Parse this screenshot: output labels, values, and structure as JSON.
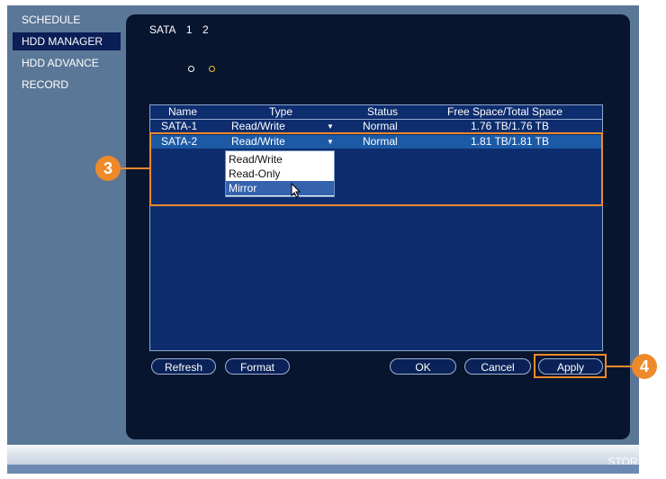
{
  "sidebar": {
    "items": [
      {
        "label": "SCHEDULE"
      },
      {
        "label": "HDD MANAGER"
      },
      {
        "label": "HDD ADVANCE"
      },
      {
        "label": "RECORD"
      }
    ]
  },
  "header": {
    "title": "SATA",
    "ports": [
      "1",
      "2"
    ]
  },
  "table": {
    "columns": [
      "Name",
      "Type",
      "Status",
      "Free Space/Total Space"
    ],
    "rows": [
      {
        "name": "SATA-1",
        "type": "Read/Write",
        "status": "Normal",
        "space": "1.76 TB/1.76 TB"
      },
      {
        "name": "SATA-2",
        "type": "Read/Write",
        "status": "Normal",
        "space": "1.81 TB/1.81 TB"
      }
    ]
  },
  "type_dropdown": {
    "options": [
      "Read/Write",
      "Read-Only",
      "Mirror"
    ],
    "highlighted": "Mirror"
  },
  "buttons": {
    "refresh": "Refresh",
    "format": "Format",
    "ok": "OK",
    "cancel": "Cancel",
    "apply": "Apply"
  },
  "callouts": {
    "step3": "3",
    "step4": "4"
  },
  "footer": {
    "section": "STORAGE"
  },
  "colors": {
    "accent": "#f08a2b",
    "panel": "#07152e",
    "selected_row": "#1c5aa6"
  }
}
